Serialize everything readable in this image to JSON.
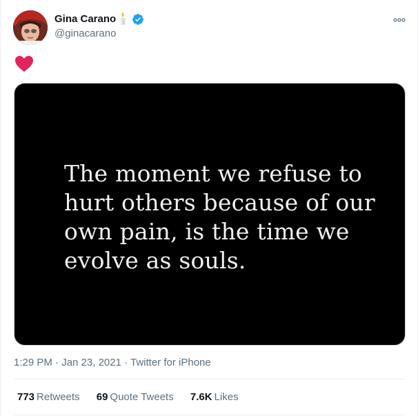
{
  "author": {
    "name": "Gina Carano",
    "handle": "@ginacarano",
    "badges": [
      "candle-icon",
      "verified-icon"
    ],
    "verified_color": "#1da1f2"
  },
  "tweet": {
    "emoji": "heart-icon",
    "heart_color": "#e0245e",
    "media_quote": "The moment we refuse to hurt others because of our own pain, is the time we evolve as souls.",
    "timestamp": "1:29 PM · Jan 23, 2021",
    "separator": " · ",
    "source": "Twitter for iPhone"
  },
  "stats": {
    "retweets_count": "773",
    "retweets_label": "Retweets",
    "quotes_count": "69",
    "quotes_label": "Quote Tweets",
    "likes_count": "7.6K",
    "likes_label": "Likes"
  },
  "colors": {
    "text_primary": "#0f1419",
    "text_secondary": "#5b7083",
    "media_background": "#000000"
  }
}
